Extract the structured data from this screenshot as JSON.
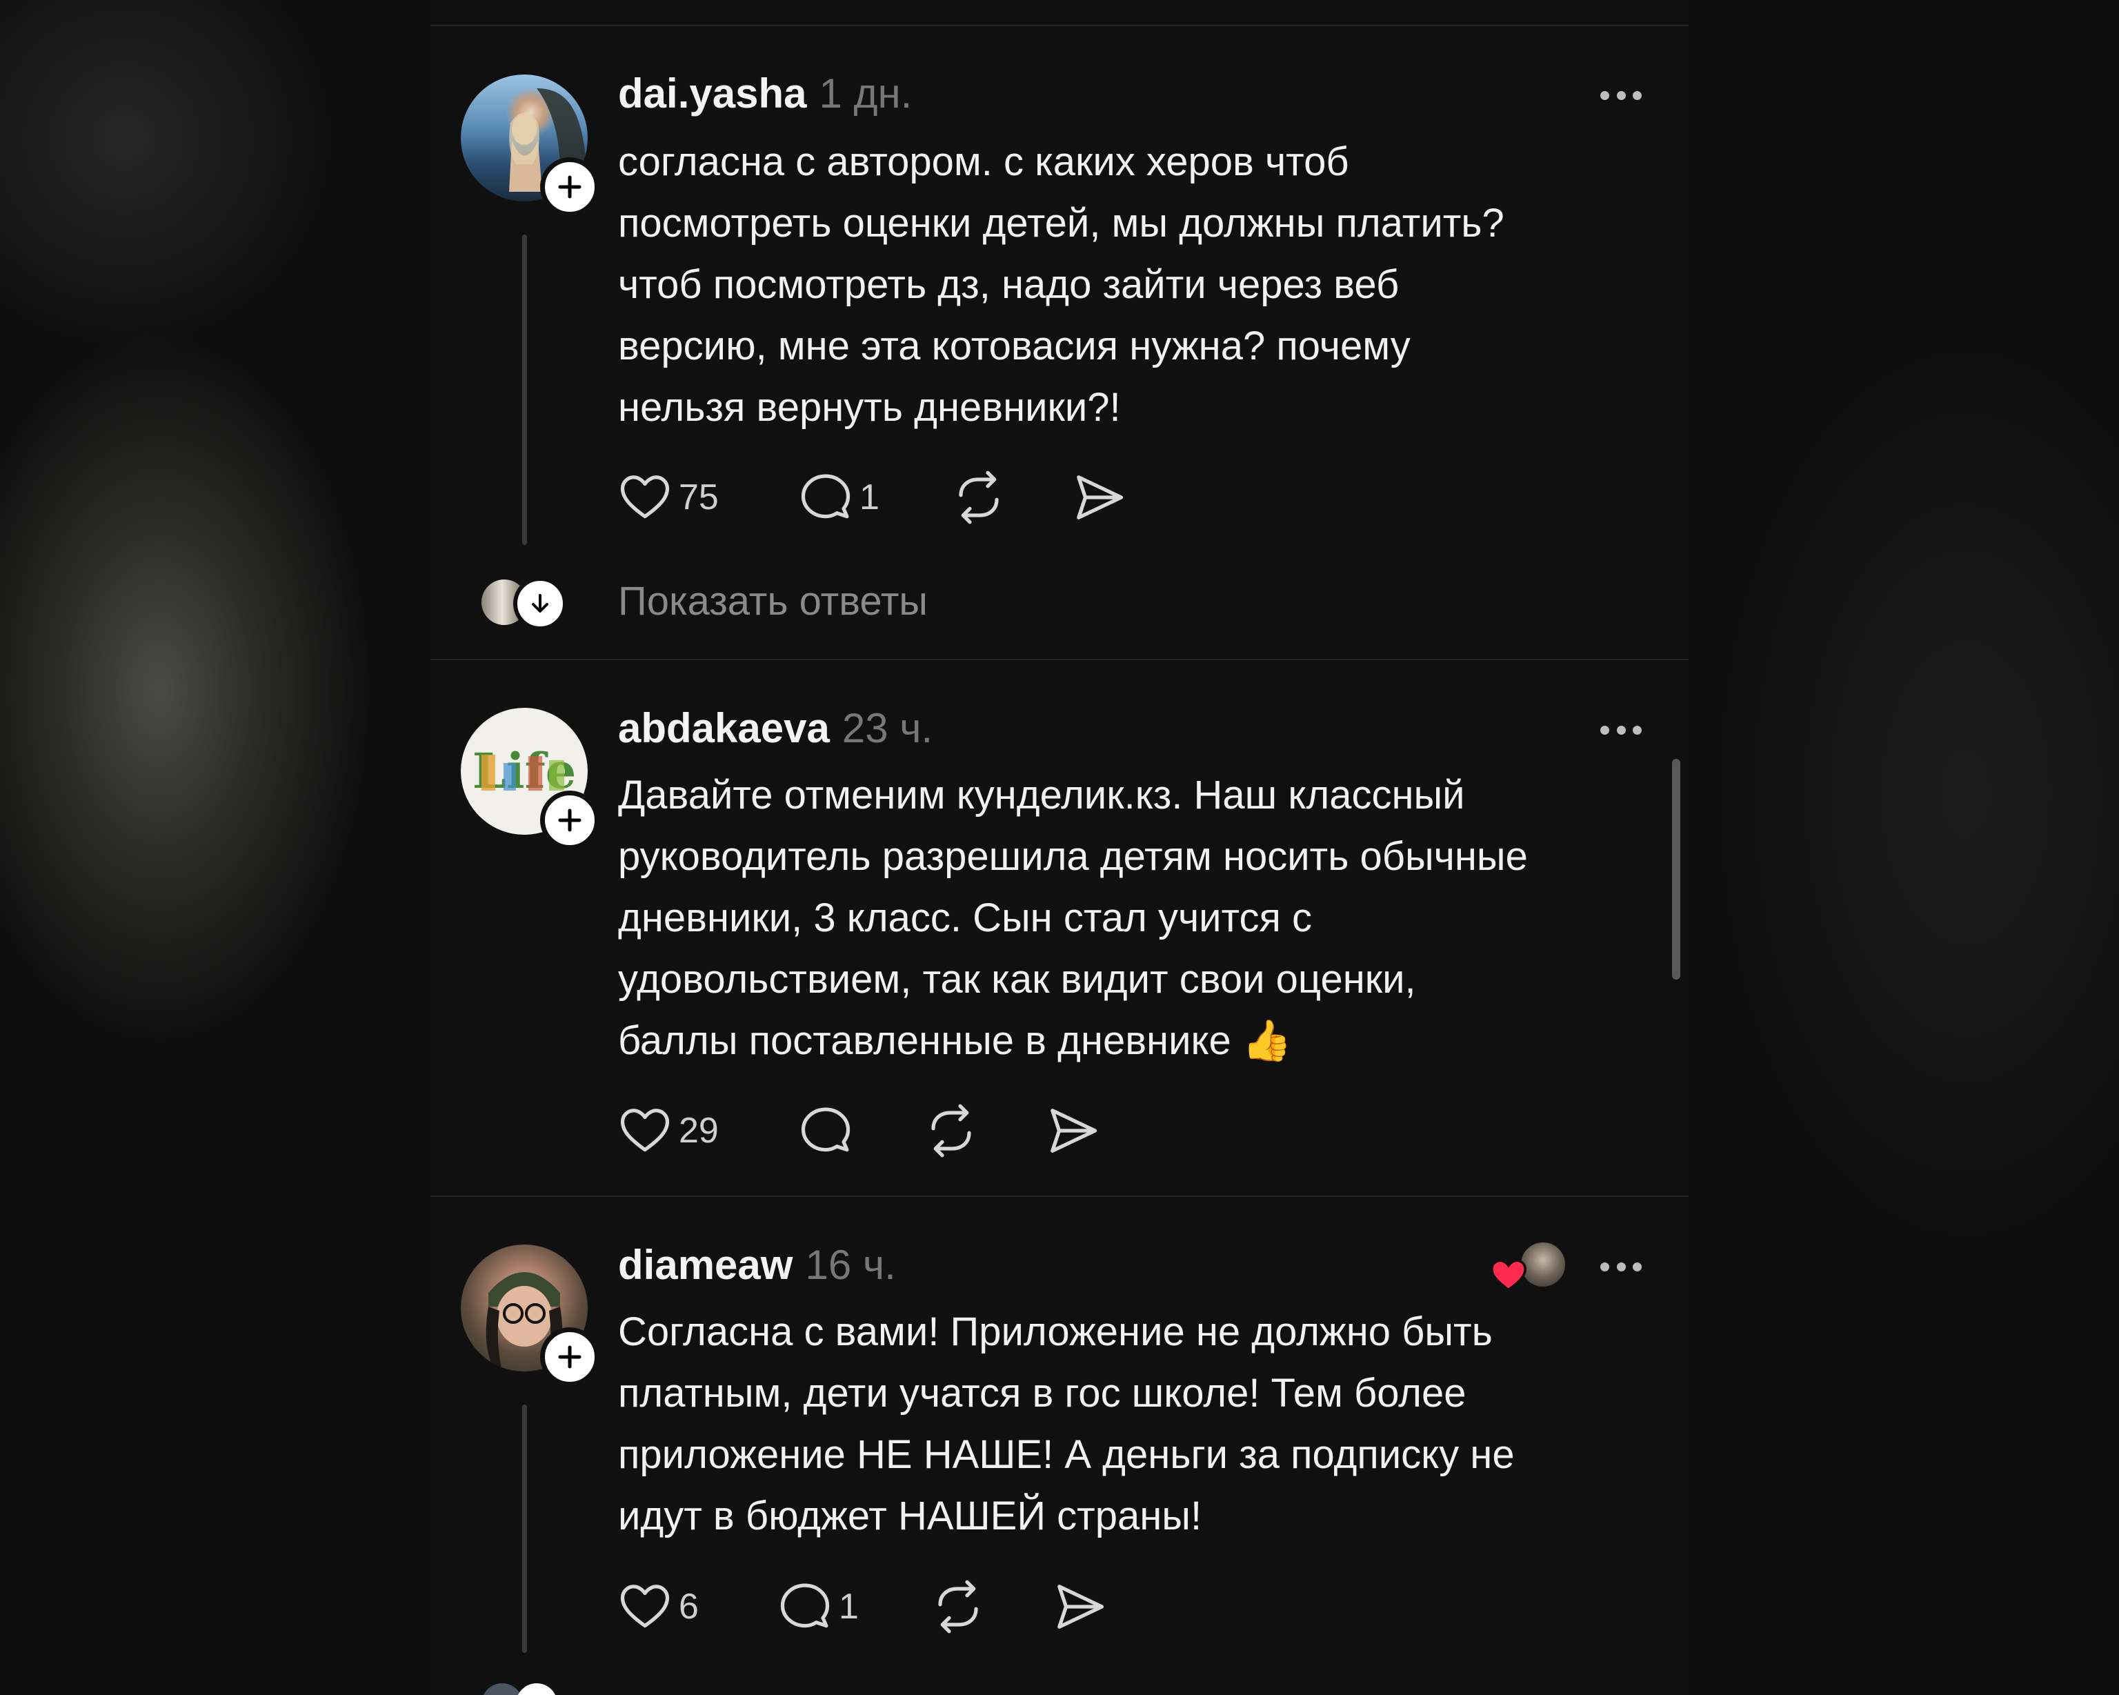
{
  "posts": [
    {
      "username": "dai.yasha",
      "time": "1 дн.",
      "text": "согласна с автором. с каких херов чтоб\nпосмотреть оценки детей, мы должны платить?\nчтоб посмотреть дз, надо зайти через веб\nверсию, мне эта котовасия нужна? почему\nнельзя вернуть дневники?!",
      "likes": "75",
      "replies": "1",
      "show_replies": "Показать ответы"
    },
    {
      "username": "abdakaeva",
      "time": "23 ч.",
      "text": "Давайте отменим кунделик.кз. Наш классный\nруководитель разрешила детям носить обычные\nдневники, 3 класс. Сын стал учится с\nудовольствием, так как видит свои оценки,\nбаллы поставленные в дневнике 👍",
      "likes": "29",
      "replies": ""
    },
    {
      "username": "diameaw",
      "time": "16 ч.",
      "text": "Согласна с вами! Приложение не должно быть\nплатным, дети учатся в гос школе! Тем более\nприложение НЕ НАШЕ! А деньги за подписку не\nидут в бюджет НАШЕЙ страны!",
      "likes": "6",
      "replies": "1"
    }
  ],
  "icons": {
    "like": "heart-icon",
    "reply": "comment-bubble-icon",
    "repost": "repost-icon",
    "share": "send-icon",
    "more": "more-dots-icon",
    "follow": "plus-icon",
    "expand": "arrow-down-icon"
  },
  "colors": {
    "background": "#101010",
    "text": "#f1f1f1",
    "muted": "#777777",
    "liked_heart": "#ff2a4d"
  }
}
